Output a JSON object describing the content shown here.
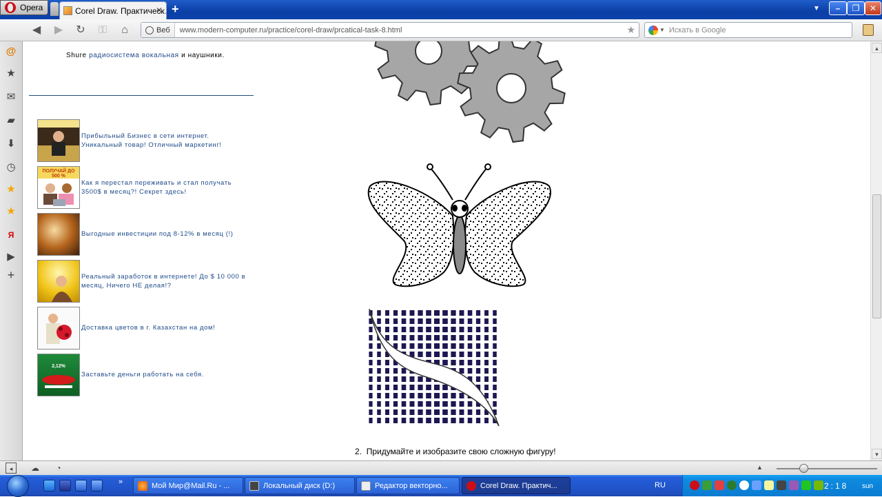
{
  "browser": {
    "menu_label": "Opera",
    "active_tab_title": "Corel Draw. Практическ…",
    "new_tab_symbol": "+",
    "address_prefix": "Веб",
    "url": "www.modern-computer.ru/practice/corel-draw/prcatical-task-8.html",
    "search_placeholder": "Искать в Google"
  },
  "page": {
    "shure_prefix": "Shure ",
    "shure_link": "радиосистема вокальная",
    "shure_suffix": " и наушники.",
    "ads": [
      {
        "line1": "Прибыльный Бизнес в сети интернет.",
        "line2": "Уникальный товар! Отличный маркетинг!"
      },
      {
        "line1": "Как я перестал переживать и стал получать",
        "line2": "3500$ в месяц?! Секрет здесь!"
      },
      {
        "line1": "Выгодные инвестиции под 8-12% в месяц (!)",
        "line2": ""
      },
      {
        "line1": "Реальный заработок в интернете! До $ 10 000 в",
        "line2": "месяц, Ничего НЕ делая!?"
      },
      {
        "line1": "Доставка цветов в г. Казахстан на дом!",
        "line2": ""
      },
      {
        "line1": "Заставьте деньги работать на себя.",
        "line2": ""
      }
    ],
    "ad_image_captions": [
      "ПОЛУЧАЙ ДО 500 %",
      "2,12%"
    ],
    "task_number": "2.",
    "task_text": "Придумайте и изобразите свою сложную фигуру!"
  },
  "taskbar": {
    "tasks": [
      "Мой Мир@Mail.Ru - ...",
      "Локальный диск (D:)",
      "Редактор векторно...",
      "Corel Draw. Практич..."
    ],
    "language": "RU",
    "clock": "2:18",
    "clock_suffix": "sun"
  },
  "colors": {
    "link": "#1e4a8a",
    "gear_fill": "#a6a6a6",
    "pattern_fill": "#1d1752",
    "taskbar": "#245edb"
  }
}
